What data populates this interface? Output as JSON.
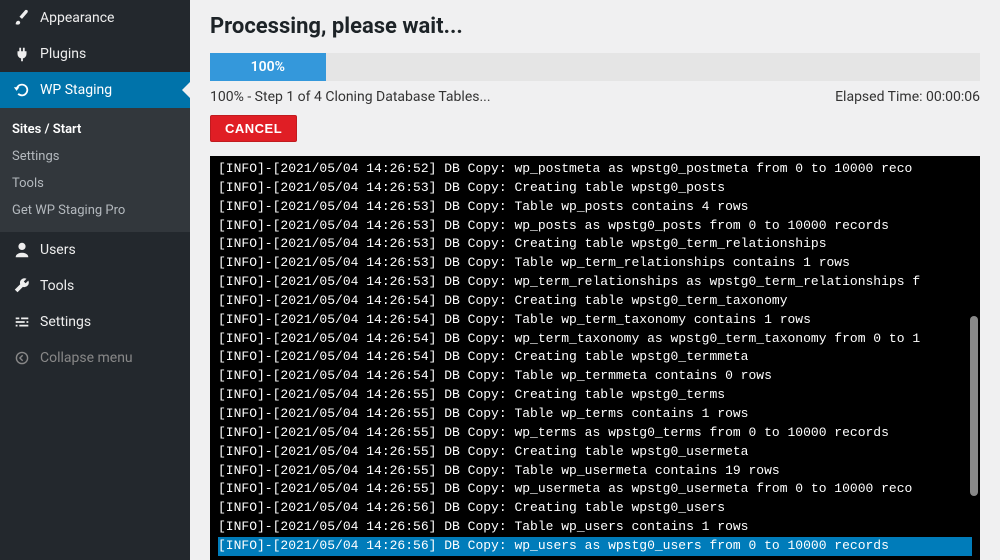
{
  "sidebar": {
    "items": [
      {
        "label": "Appearance",
        "icon": "brush"
      },
      {
        "label": "Plugins",
        "icon": "plugin"
      },
      {
        "label": "WP Staging",
        "icon": "refresh",
        "active": true
      },
      {
        "label": "Users",
        "icon": "user"
      },
      {
        "label": "Tools",
        "icon": "wrench"
      },
      {
        "label": "Settings",
        "icon": "sliders"
      },
      {
        "label": "Collapse menu",
        "icon": "collapse"
      }
    ],
    "sub": [
      {
        "label": "Sites / Start",
        "active": true
      },
      {
        "label": "Settings"
      },
      {
        "label": "Tools"
      },
      {
        "label": "Get WP Staging Pro"
      }
    ]
  },
  "main": {
    "title": "Processing, please wait...",
    "progress_text": "100%",
    "status_text": "100% - Step 1 of 4 Cloning Database Tables...",
    "elapsed_label": "Elapsed Time: 00:00:06",
    "cancel_label": "CANCEL"
  },
  "log": [
    "[INFO]-[2021/05/04 14:26:52] DB Copy: wp_postmeta as wpstg0_postmeta from 0 to 10000 reco",
    "[INFO]-[2021/05/04 14:26:53] DB Copy: Creating table wpstg0_posts",
    "[INFO]-[2021/05/04 14:26:53] DB Copy: Table wp_posts contains 4 rows",
    "[INFO]-[2021/05/04 14:26:53] DB Copy: wp_posts as wpstg0_posts from 0 to 10000 records",
    "[INFO]-[2021/05/04 14:26:53] DB Copy: Creating table wpstg0_term_relationships",
    "[INFO]-[2021/05/04 14:26:53] DB Copy: Table wp_term_relationships contains 1 rows",
    "[INFO]-[2021/05/04 14:26:53] DB Copy: wp_term_relationships as wpstg0_term_relationships f",
    "[INFO]-[2021/05/04 14:26:54] DB Copy: Creating table wpstg0_term_taxonomy",
    "[INFO]-[2021/05/04 14:26:54] DB Copy: Table wp_term_taxonomy contains 1 rows",
    "[INFO]-[2021/05/04 14:26:54] DB Copy: wp_term_taxonomy as wpstg0_term_taxonomy from 0 to 1",
    "[INFO]-[2021/05/04 14:26:54] DB Copy: Creating table wpstg0_termmeta",
    "[INFO]-[2021/05/04 14:26:54] DB Copy: Table wp_termmeta contains 0 rows",
    "[INFO]-[2021/05/04 14:26:55] DB Copy: Creating table wpstg0_terms",
    "[INFO]-[2021/05/04 14:26:55] DB Copy: Table wp_terms contains 1 rows",
    "[INFO]-[2021/05/04 14:26:55] DB Copy: wp_terms as wpstg0_terms from 0 to 10000 records",
    "[INFO]-[2021/05/04 14:26:55] DB Copy: Creating table wpstg0_usermeta",
    "[INFO]-[2021/05/04 14:26:55] DB Copy: Table wp_usermeta contains 19 rows",
    "[INFO]-[2021/05/04 14:26:55] DB Copy: wp_usermeta as wpstg0_usermeta from 0 to 10000 reco",
    "[INFO]-[2021/05/04 14:26:56] DB Copy: Creating table wpstg0_users",
    "[INFO]-[2021/05/04 14:26:56] DB Copy: Table wp_users contains 1 rows",
    "[INFO]-[2021/05/04 14:26:56] DB Copy: wp_users as wpstg0_users from 0 to 10000 records"
  ],
  "log_highlight_index": 20
}
